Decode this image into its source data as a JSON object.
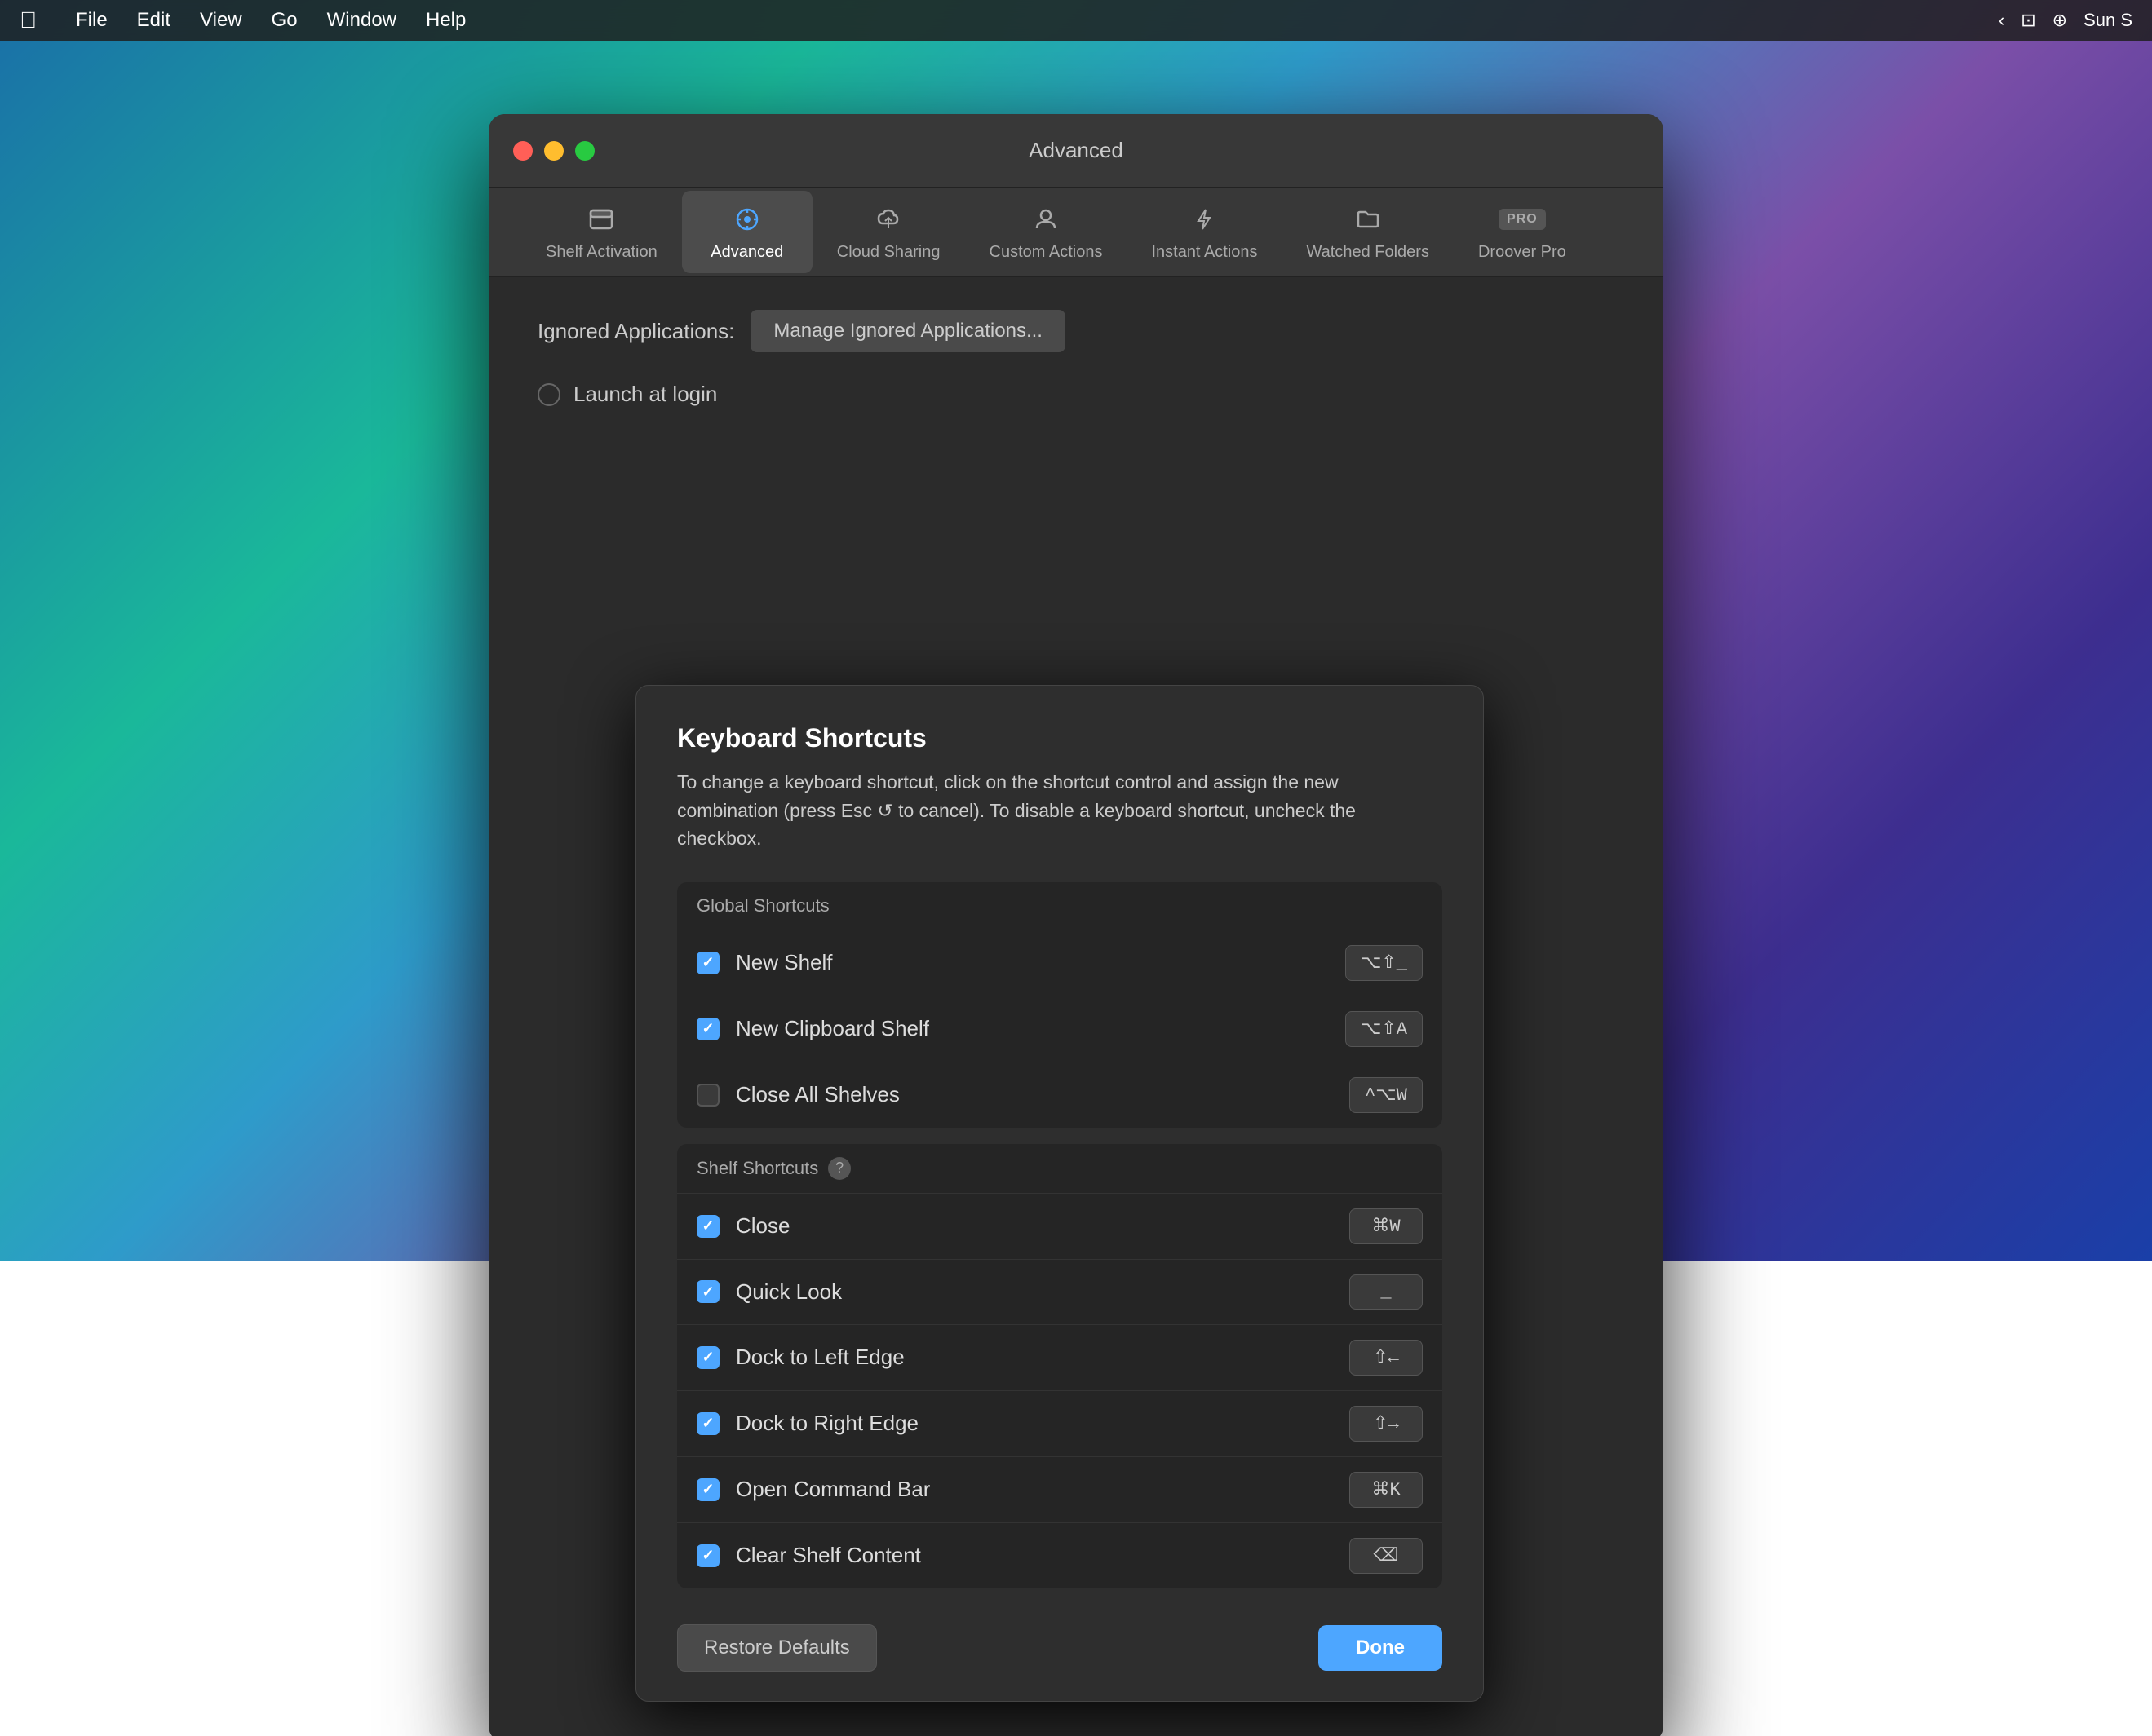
{
  "menubar": {
    "items": [
      "File",
      "Edit",
      "View",
      "Go",
      "Window",
      "Help"
    ],
    "right": "Sun S"
  },
  "window": {
    "title": "Advanced",
    "traffic_lights": [
      "close",
      "minimize",
      "maximize"
    ]
  },
  "tabs": [
    {
      "id": "shelf-activation",
      "label": "Shelf Activation",
      "icon": "⬛"
    },
    {
      "id": "advanced",
      "label": "Advanced",
      "icon": "⚙️",
      "active": true
    },
    {
      "id": "cloud-sharing",
      "label": "Cloud Sharing",
      "icon": "📎"
    },
    {
      "id": "custom-actions",
      "label": "Custom Actions",
      "icon": "👤"
    },
    {
      "id": "instant-actions",
      "label": "Instant Actions",
      "icon": "⚡"
    },
    {
      "id": "watched-folders",
      "label": "Watched Folders",
      "icon": "🗂️"
    },
    {
      "id": "droover-pro",
      "label": "Droover Pro",
      "icon": "PRO"
    }
  ],
  "content": {
    "ignored_apps_label": "Ignored Applications:",
    "manage_btn": "Manage Ignored Applications...",
    "launch_label": "Launch at login"
  },
  "dialog": {
    "title": "Keyboard Shortcuts",
    "description": "To change a keyboard shortcut, click on the shortcut control and assign the new combination (press Esc ↺ to cancel). To disable a keyboard shortcut, uncheck the checkbox.",
    "global_section": "Global Shortcuts",
    "shelf_section": "Shelf Shortcuts",
    "global_shortcuts": [
      {
        "name": "New Shelf",
        "checked": true,
        "key": "⌥⇧_"
      },
      {
        "name": "New Clipboard Shelf",
        "checked": true,
        "key": "⌥⇧A"
      },
      {
        "name": "Close All Shelves",
        "checked": false,
        "key": "^⌥W"
      }
    ],
    "shelf_shortcuts": [
      {
        "name": "Close",
        "checked": true,
        "key": "⌘W"
      },
      {
        "name": "Quick Look",
        "checked": true,
        "key": "_"
      },
      {
        "name": "Dock to Left Edge",
        "checked": true,
        "key": "⇧←"
      },
      {
        "name": "Dock to Right Edge",
        "checked": true,
        "key": "⇧→"
      },
      {
        "name": "Open Command Bar",
        "checked": true,
        "key": "⌘K"
      },
      {
        "name": "Clear Shelf Content",
        "checked": true,
        "key": "⌫"
      }
    ],
    "restore_btn": "Restore Defaults",
    "done_btn": "Done"
  }
}
